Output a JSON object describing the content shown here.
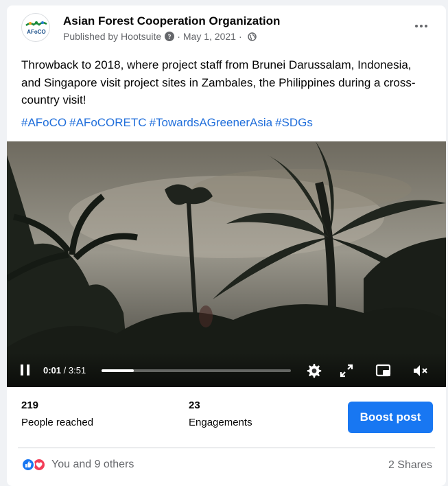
{
  "post": {
    "page_name": "Asian Forest Cooperation Organization",
    "avatar_text": "AFoCO",
    "published_by": "Published by Hootsuite",
    "date": "May 1, 2021",
    "separator": "·",
    "body": "Throwback to 2018, where project staff from Brunei Darussalam, Indonesia, and Singapore visit project sites in Zambales, the Philippines during a cross-country visit!",
    "hashtags": [
      "#AFoCO",
      "#AFoCORETC",
      "#TowardsAGreenerAsia",
      "#SDGs"
    ]
  },
  "video": {
    "current_time": "0:01",
    "duration": "/ 3:51",
    "progress_fraction": 0.017,
    "state": "playing"
  },
  "stats": {
    "reached_value": "219",
    "reached_label": "People reached",
    "engagements_value": "23",
    "engagements_label": "Engagements",
    "boost_label": "Boost post"
  },
  "footer": {
    "reactions_text": "You and 9 others",
    "shares_text": "2 Shares"
  },
  "colors": {
    "accent": "#1877f2",
    "hashtag": "#216fdb",
    "secondary_text": "#65676b",
    "love": "#f33e58"
  },
  "icons": [
    "info-icon",
    "globe-icon",
    "more-icon",
    "pause-icon",
    "settings-icon",
    "fullscreen-icon",
    "pip-icon",
    "mute-icon",
    "like-reaction-icon",
    "love-reaction-icon"
  ]
}
